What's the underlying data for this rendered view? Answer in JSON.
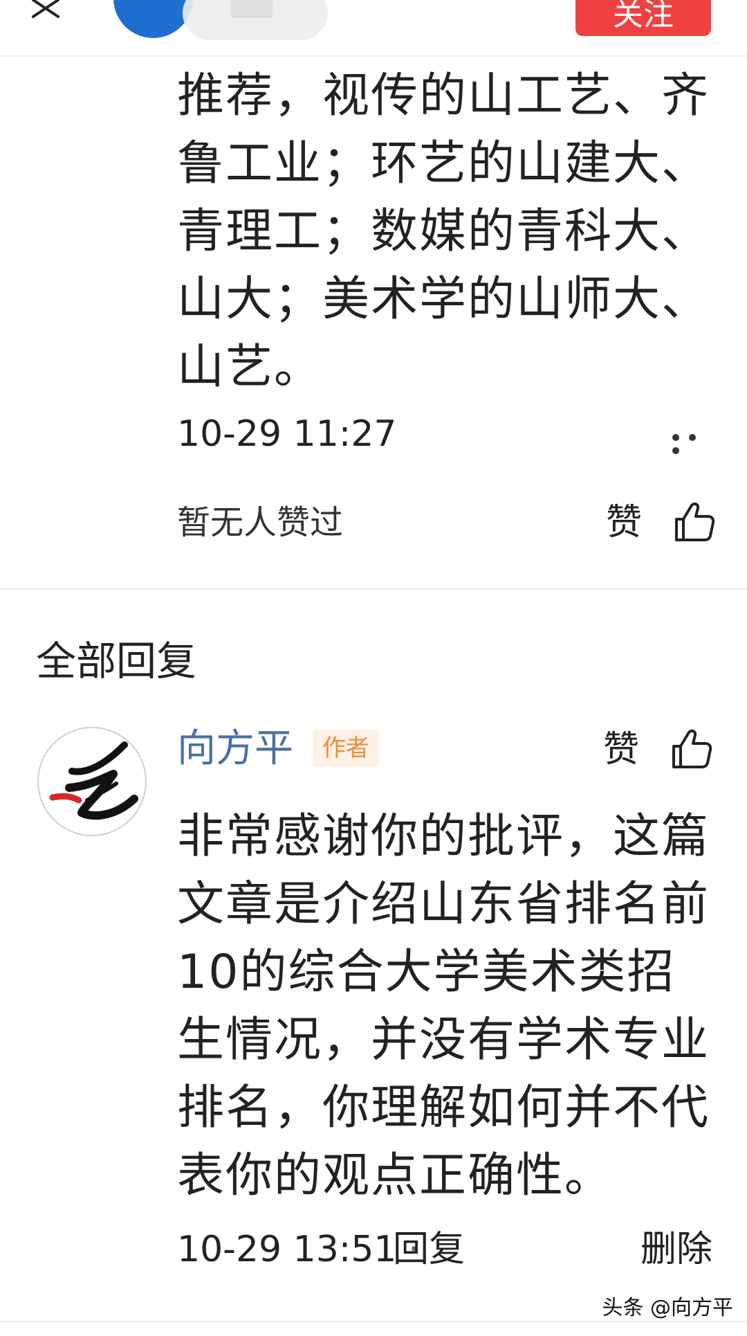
{
  "header": {
    "follow_label": "关注"
  },
  "comment": {
    "text": "推荐，视传的山工艺、齐鲁工业；环艺的山建大、青理工；数媒的青科大、山大；美术学的山师大、山艺。",
    "time": "10-29 11:27",
    "likes_text": "暂无人赞过",
    "like_label": "赞"
  },
  "replies": {
    "heading": "全部回复",
    "items": [
      {
        "author": "向方平",
        "badge": "作者",
        "like_label": "赞",
        "text": "非常感谢你的批评，这篇文章是介绍山东省排名前10的综合大学美术类招生情况，并没有学术专业排名，你理解如何并不代表你的观点正确性。",
        "time": "10-29 13:51",
        "separator": "·",
        "reply_label": "回复",
        "delete_label": "删除"
      }
    ]
  },
  "watermark": "头条 @向方平",
  "colors": {
    "follow_button": "#f04142",
    "author_name": "#4a6fa5",
    "badge_text": "#f08a3a",
    "badge_bg": "#fdf1e6"
  },
  "icons": [
    "close-icon",
    "more-icon",
    "thumbs-up-icon"
  ]
}
